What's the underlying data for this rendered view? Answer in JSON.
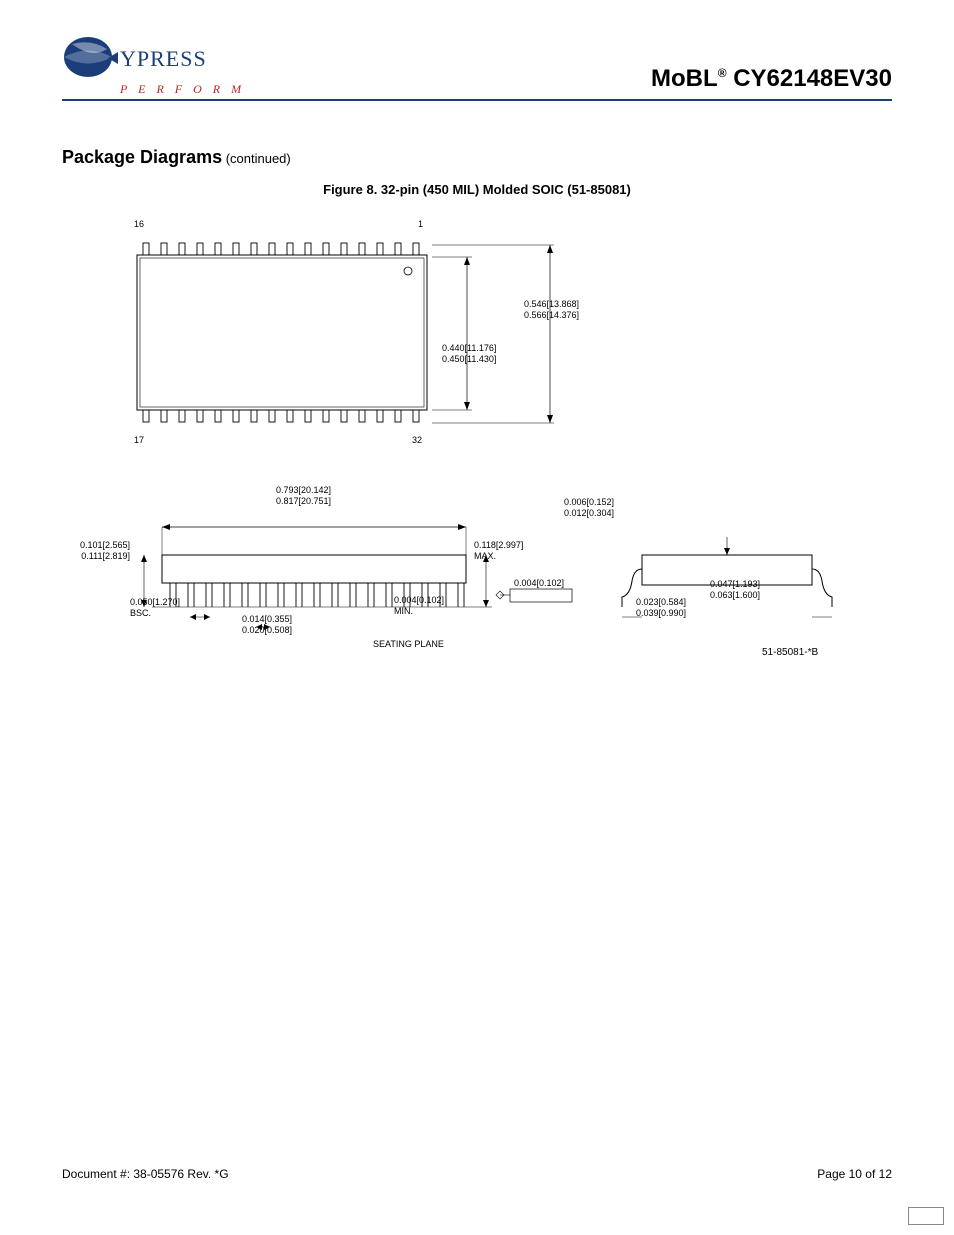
{
  "header": {
    "brand_word": "YPRESS",
    "brand_sub": "P E R F O R M",
    "title_prefix": "MoBL",
    "title_reg": "®",
    "title_part": " CY62148EV30"
  },
  "section": {
    "title": "Package Diagrams",
    "cont": " (continued)"
  },
  "figure": {
    "caption": "Figure 8.  32-pin (450 MIL) Molded SOIC (51-85081)"
  },
  "topview": {
    "pin16": "16",
    "pin1": "1",
    "pin17": "17",
    "pin32": "32",
    "body_w_a": "0.440[11.176]",
    "body_w_b": "0.450[11.430]",
    "overall_w_a": "0.546[13.868]",
    "overall_w_b": "0.566[14.376]"
  },
  "sideview": {
    "len_a": "0.793[20.142]",
    "len_b": "0.817[20.751]",
    "h_a": "0.101[2.565]",
    "h_b": "0.111[2.819]",
    "pitch": "0.050[1.270]",
    "pitch_sub": "BSC.",
    "lead_w_a": "0.014[0.355]",
    "lead_w_b": "0.020[0.508]",
    "coplanar": "0.004[0.102]",
    "coplanar_sub": "MIN.",
    "seating": "SEATING PLANE",
    "flat": "0.004[0.102]",
    "standoff": "0.118[2.997]",
    "standoff_sub": "MAX.",
    "lead_t_a": "0.006[0.152]",
    "lead_t_b": "0.012[0.304]",
    "foot_a": "0.023[0.584]",
    "foot_b": "0.039[0.990]",
    "foot_ext_a": "0.047[1.193]",
    "foot_ext_b": "0.063[1.600]",
    "drawing_rev": "51-85081-*B"
  },
  "footer": {
    "doc": "Document #: 38-05576 Rev. *G",
    "page": "Page 10 of 12"
  }
}
